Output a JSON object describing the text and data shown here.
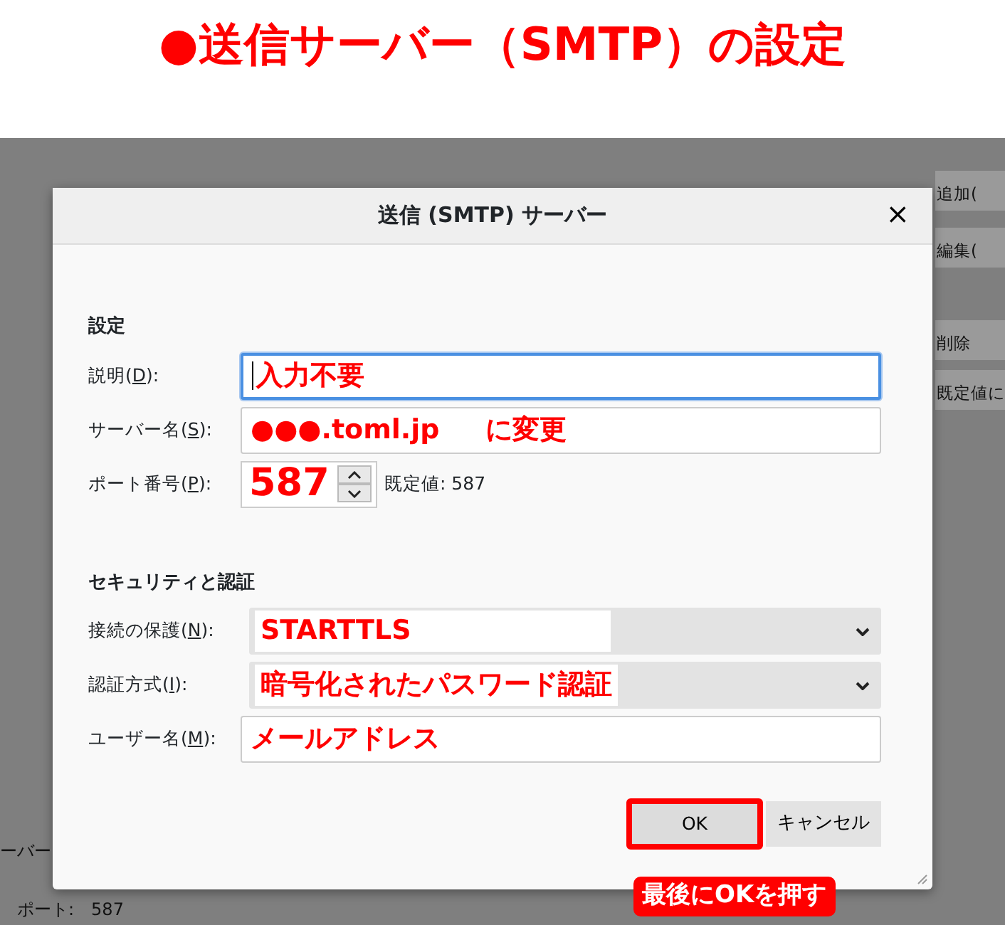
{
  "banner": {
    "title": "●送信サーバー（SMTP）の設定"
  },
  "background": {
    "side_buttons": [
      "追加(",
      "編集(",
      "削除",
      "既定値に"
    ],
    "fragments": [
      {
        "kind": "heading",
        "text": "ーバー"
      },
      {
        "kind": "port",
        "text": "ポート:　587"
      }
    ]
  },
  "dialog": {
    "title": "送信 (SMTP) サーバー",
    "close": "×",
    "sections": [
      {
        "heading": "設定",
        "fields": [
          {
            "kind": "text",
            "label_before": "説明(",
            "access_key": "D",
            "label_after": "):",
            "value": "入力不要",
            "focused": true
          },
          {
            "kind": "text",
            "label_before": "サーバー名(",
            "access_key": "S",
            "label_after": "):",
            "value": "●●●.toml.jp　  に変更",
            "focused": false
          },
          {
            "kind": "spin",
            "label_before": "ポート番号(",
            "access_key": "P",
            "label_after": "):",
            "value": "587",
            "default_label": "既定値:",
            "default_value": "587",
            "focused": false
          }
        ]
      },
      {
        "heading": "セキュリティと認証",
        "fields": [
          {
            "kind": "select",
            "label_before": "接続の保護(",
            "access_key": "N",
            "label_after": "):",
            "value": "STARTTLS",
            "focused": false
          },
          {
            "kind": "select",
            "label_before": "認証方式(",
            "access_key": "I",
            "label_after": "):",
            "value": "暗号化されたパスワード認証",
            "focused": false
          },
          {
            "kind": "text",
            "label_before": "ユーザー名(",
            "access_key": "M",
            "label_after": "):",
            "value": "メールアドレス",
            "focused": false
          }
        ]
      }
    ],
    "buttons": [
      {
        "label": "OK",
        "highlighted": true
      },
      {
        "label": "キャンセル",
        "highlighted": false
      }
    ],
    "callout": "最後にOKを押す"
  }
}
